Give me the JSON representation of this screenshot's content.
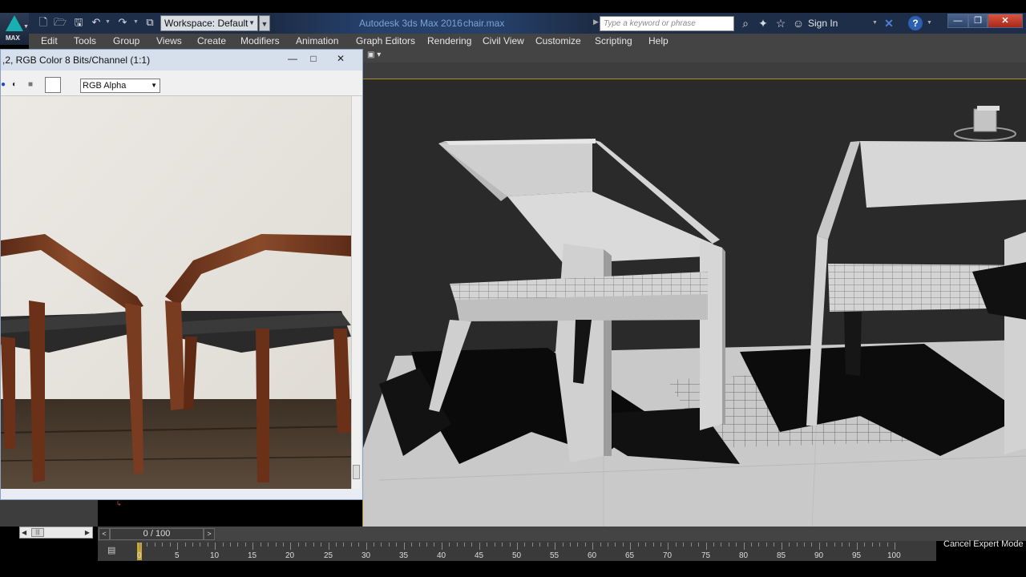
{
  "app": {
    "title": "Autodesk 3ds Max 2016",
    "file": "chair.max",
    "logo_text": "MAX"
  },
  "quick_access": {
    "workspace_label": "Workspace: Default",
    "icons": [
      "new-icon",
      "open-icon",
      "save-icon",
      "undo-icon",
      "redo-icon",
      "project-folder-icon"
    ]
  },
  "search": {
    "placeholder": "Type a keyword or phrase"
  },
  "header": {
    "sign_in": "Sign In"
  },
  "menu": {
    "items": [
      "Edit",
      "Tools",
      "Group",
      "Views",
      "Create",
      "Modifiers",
      "Animation",
      "Graph Editors",
      "Rendering",
      "Civil View",
      "Customize",
      "Scripting",
      "Help"
    ]
  },
  "frame_buffer": {
    "title": ",2, RGB Color 8 Bits/Channel (1:1)",
    "channel": "RGB Alpha"
  },
  "timeline": {
    "frame_display": "0 / 100",
    "ticks": [
      "0",
      "5",
      "10",
      "15",
      "20",
      "25",
      "30",
      "35",
      "40",
      "45",
      "50",
      "55",
      "60",
      "65",
      "70",
      "75",
      "80",
      "85",
      "90",
      "95",
      "100"
    ]
  },
  "status": {
    "cancel_expert": "Cancel Expert Mode"
  },
  "colors": {
    "accent_gold": "#a88b28",
    "title_blue": "#7ea2d2",
    "close_red": "#c0392b"
  }
}
